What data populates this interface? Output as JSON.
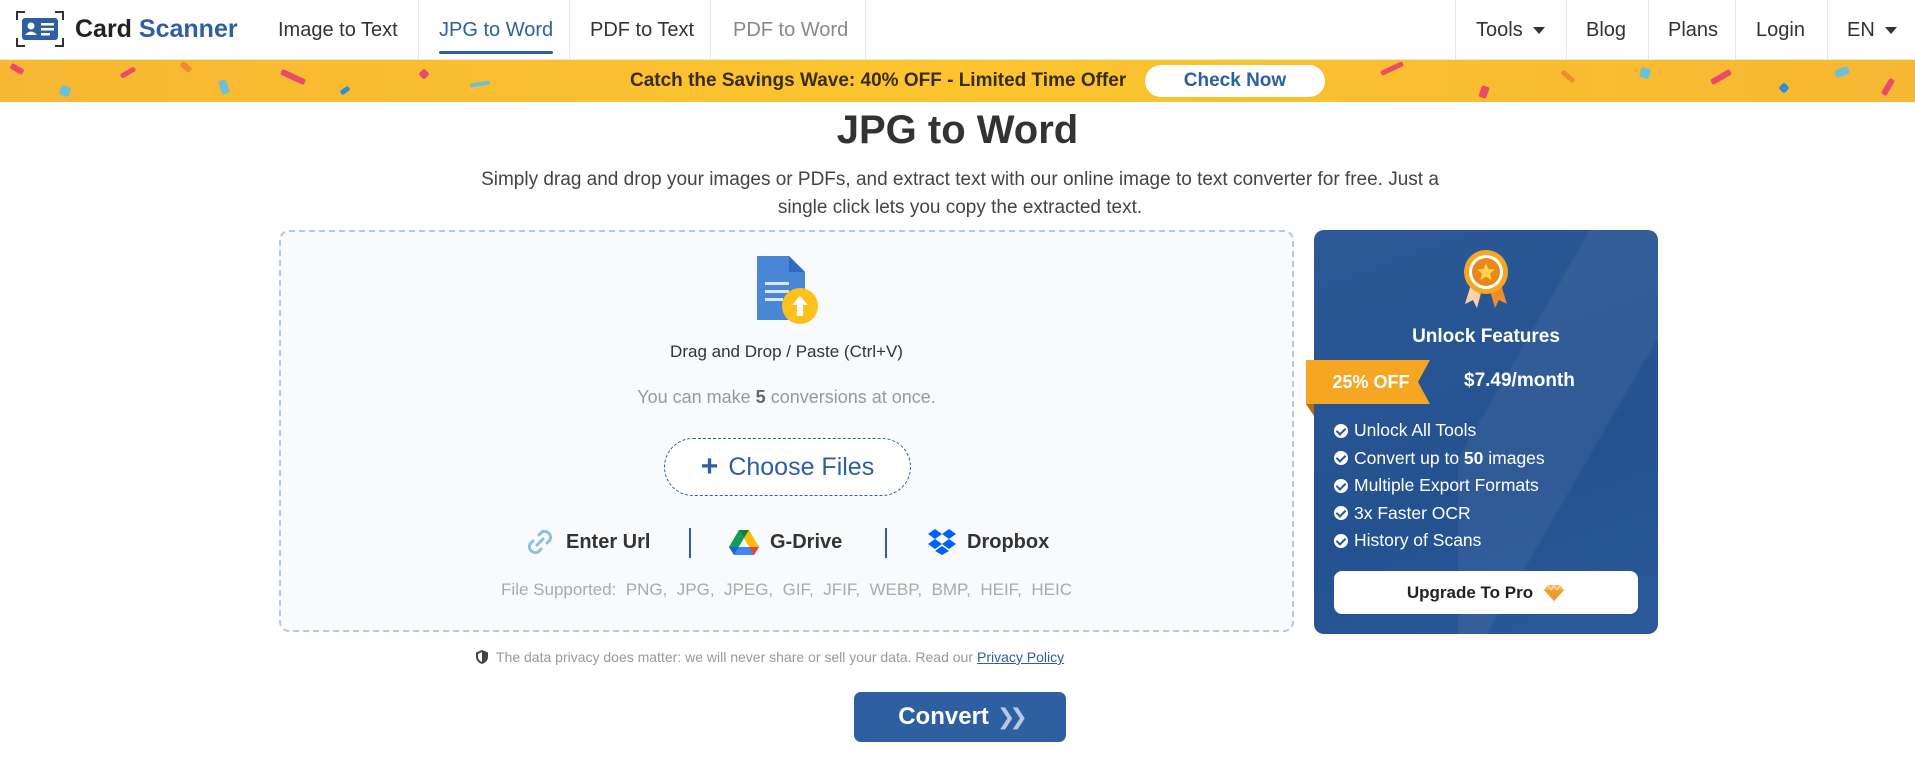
{
  "header": {
    "logo": {
      "brand_a": "Card",
      "brand_b": "Scanner",
      "icon": "id-card-icon"
    },
    "nav": [
      {
        "label": "Image to Text"
      },
      {
        "label": "JPG to Word",
        "active": true
      },
      {
        "label": "PDF to Text"
      },
      {
        "label": "PDF to Word"
      }
    ],
    "right_nav": {
      "tools": "Tools",
      "blog": "Blog",
      "plans": "Plans",
      "login": "Login",
      "lang": "EN"
    }
  },
  "banner": {
    "text": "Catch the Savings Wave: 40% OFF - Limited Time Offer",
    "button": "Check Now"
  },
  "main": {
    "title": "JPG to Word",
    "subtitle": "Simply drag and drop your images or PDFs, and extract text with our online image to text converter for free. Just a single click lets you copy the extracted text."
  },
  "upload": {
    "drop_text": "Drag and Drop / Paste (Ctrl+V)",
    "limit_prefix": "You can make",
    "limit_count": "5",
    "limit_suffix": "conversions at once.",
    "choose_label": "Choose Files",
    "sources": {
      "url": "Enter Url",
      "gdrive": "G-Drive",
      "dropbox": "Dropbox"
    },
    "supported_label": "File Supported:",
    "formats": "PNG,  JPG,  JPEG,  GIF,  JFIF,  WEBP,  BMP,  HEIF,  HEIC"
  },
  "pro": {
    "title": "Unlock Features",
    "discount": "25% OFF",
    "price": "$7.49/month",
    "features": [
      {
        "pre": "Unlock All Tools",
        "bold": "",
        "post": ""
      },
      {
        "pre": "Convert up to ",
        "bold": "50",
        "post": " images"
      },
      {
        "pre": "Multiple Export Formats",
        "bold": "",
        "post": ""
      },
      {
        "pre": "3x Faster OCR",
        "bold": "",
        "post": ""
      },
      {
        "pre": "History of Scans",
        "bold": "",
        "post": ""
      }
    ],
    "upgrade_label": "Upgrade To Pro"
  },
  "privacy": {
    "text": "The data privacy does matter: we will never share or sell your data. Read our",
    "link": "Privacy Policy"
  },
  "convert_label": "Convert",
  "colors": {
    "primary": "#2d5fa1",
    "banner": "#fcc52e",
    "pro_card": "#2c5896",
    "ribbon": "#f5a623"
  }
}
